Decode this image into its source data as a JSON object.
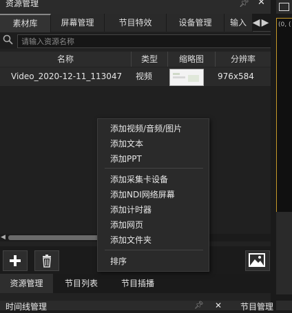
{
  "resource_panel": {
    "title": "资源管理",
    "tabs": [
      {
        "label": "素材库",
        "active": true
      },
      {
        "label": "屏幕管理"
      },
      {
        "label": "节目特效"
      },
      {
        "label": "设备管理"
      },
      {
        "label": "输入"
      }
    ],
    "search": {
      "placeholder": "请输入资源名称"
    },
    "table": {
      "columns": [
        "名称",
        "类型",
        "缩略图",
        "分辨率"
      ],
      "rows": [
        {
          "name": "Video_2020-12-11_113047",
          "type": "视频",
          "resolution": "976x584"
        }
      ]
    },
    "bottom_tabs": [
      {
        "label": "资源管理",
        "active": true
      },
      {
        "label": "节目列表"
      },
      {
        "label": "节目插播"
      }
    ]
  },
  "context_menu": {
    "items": [
      "添加视频/音频/图片",
      "添加文本",
      "添加PPT",
      "添加采集卡设备",
      "添加NDI网络屏幕",
      "添加计时器",
      "添加网页",
      "添加文件夹",
      "排序"
    ]
  },
  "timeline_panel": {
    "title": "时间线管理"
  },
  "right_panel": {
    "coord": "(0, (",
    "bottom_title": "节目管理"
  },
  "colors": {
    "canvas_border": "#c79a2a",
    "background": "#1b1b1b"
  }
}
